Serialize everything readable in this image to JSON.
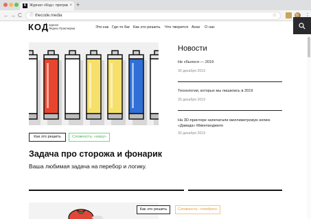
{
  "browser": {
    "tab_title": "Журнал «Код»: программи...",
    "tab_favicon": "К",
    "tab_close": "×",
    "new_tab": "+",
    "url": "thecode.media",
    "back": "←",
    "forward": "→",
    "reload": "C",
    "lock": "ⓘ",
    "star": "☆",
    "menu": "⋮"
  },
  "header": {
    "logo": "КОД",
    "logo_sub_line1": "журнал",
    "logo_sub_line2": "Яндекс.Практикума",
    "nav": [
      "Это как",
      "Где-то баг",
      "Как это решить",
      "Что творится",
      "Ахах",
      "О нас"
    ]
  },
  "article": {
    "button_label": "Как это решить",
    "difficulty_label": "Сложность: «easy»",
    "title": "Задача про сторожа и фонарик",
    "description": "Ваша любимая задача на перебор и логику."
  },
  "news": {
    "heading": "Новости",
    "items": [
      {
        "title": "Не сбылося — 2019",
        "date": "30 декабря 2019"
      },
      {
        "title": "Технологии, которых мы лишились в 2019",
        "date": "30 декабря 2019"
      },
      {
        "title": "На 3D-принтере напечатали миллиметровую копию «Давида» Микеланджело",
        "date": "30 декабря 2019"
      }
    ]
  },
  "article2": {
    "button_label": "Как это решить",
    "difficulty_label": "Сложность: «medium»"
  },
  "colors": {
    "battery_colors": [
      "#ffffff",
      "#e8452e",
      "#ffffff",
      "#f7e06a",
      "#f7e06a",
      "#2f6fd6",
      "#ffffff"
    ],
    "easy": "#45b05a",
    "medium": "#e39a3a",
    "search_bg": "#2a2a2e"
  },
  "icons": [
    "search-icon",
    "star-icon",
    "menu-icon",
    "info-icon",
    "back-icon",
    "forward-icon",
    "reload-icon"
  ]
}
